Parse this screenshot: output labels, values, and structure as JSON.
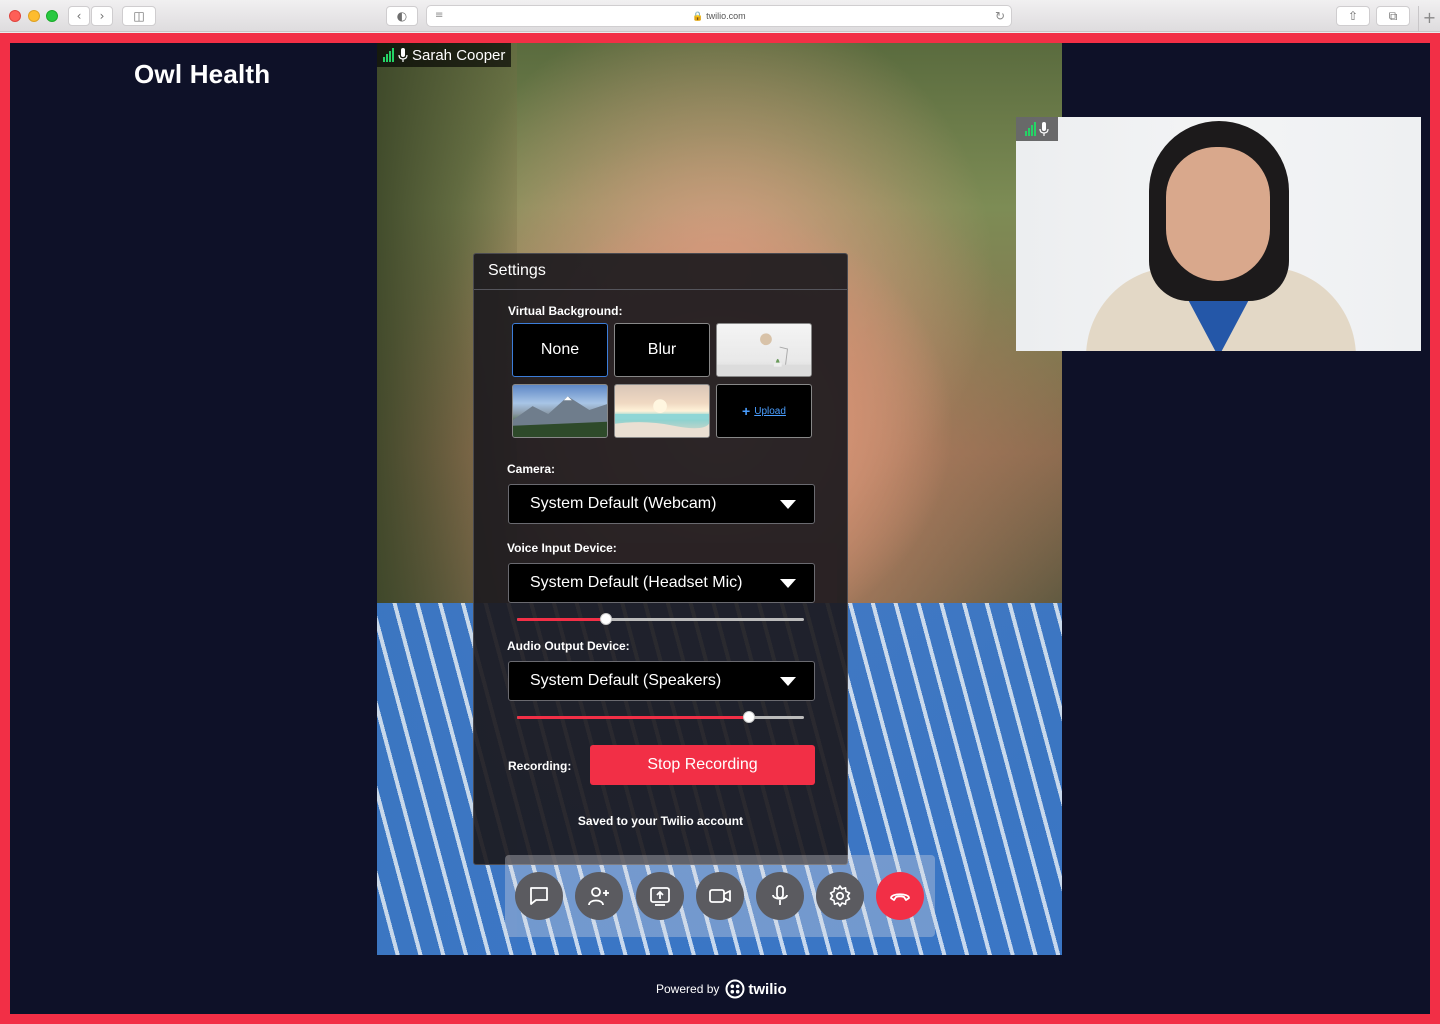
{
  "browser": {
    "url": "twilio.com"
  },
  "app": {
    "brand": "Owl Health"
  },
  "main_video": {
    "participant_name": "Sarah Cooper"
  },
  "settings": {
    "title": "Settings",
    "virtual_background_label": "Virtual Background:",
    "backgrounds": [
      {
        "label": "None",
        "selected": true
      },
      {
        "label": "Blur",
        "selected": false
      },
      {
        "label": "",
        "kind": "room-image"
      },
      {
        "label": "",
        "kind": "mountain-image"
      },
      {
        "label": "",
        "kind": "beach-image"
      },
      {
        "label": "Upload",
        "kind": "upload"
      }
    ],
    "camera_label": "Camera:",
    "camera_value": "System Default (Webcam)",
    "voice_input_label": "Voice Input Device:",
    "voice_input_value": "System Default (Headset Mic)",
    "voice_input_level": 0.31,
    "audio_output_label": "Audio Output Device:",
    "audio_output_value": "System Default (Speakers)",
    "audio_output_level": 0.81,
    "recording_label": "Recording:",
    "stop_recording_label": "Stop Recording",
    "saved_note": "Saved to your Twilio account"
  },
  "controls": [
    {
      "name": "chat",
      "icon": "chat-icon"
    },
    {
      "name": "add-participant",
      "icon": "add-person-icon"
    },
    {
      "name": "share-screen",
      "icon": "share-screen-icon"
    },
    {
      "name": "camera",
      "icon": "video-camera-icon"
    },
    {
      "name": "microphone",
      "icon": "microphone-icon"
    },
    {
      "name": "settings",
      "icon": "gear-icon"
    },
    {
      "name": "end-call",
      "icon": "hang-up-icon"
    }
  ],
  "footer": {
    "powered_by": "Powered by",
    "logo_text": "twilio"
  },
  "colors": {
    "brand_red": "#f22f46",
    "background_navy": "#0e1128",
    "signal_green": "#25d366"
  }
}
